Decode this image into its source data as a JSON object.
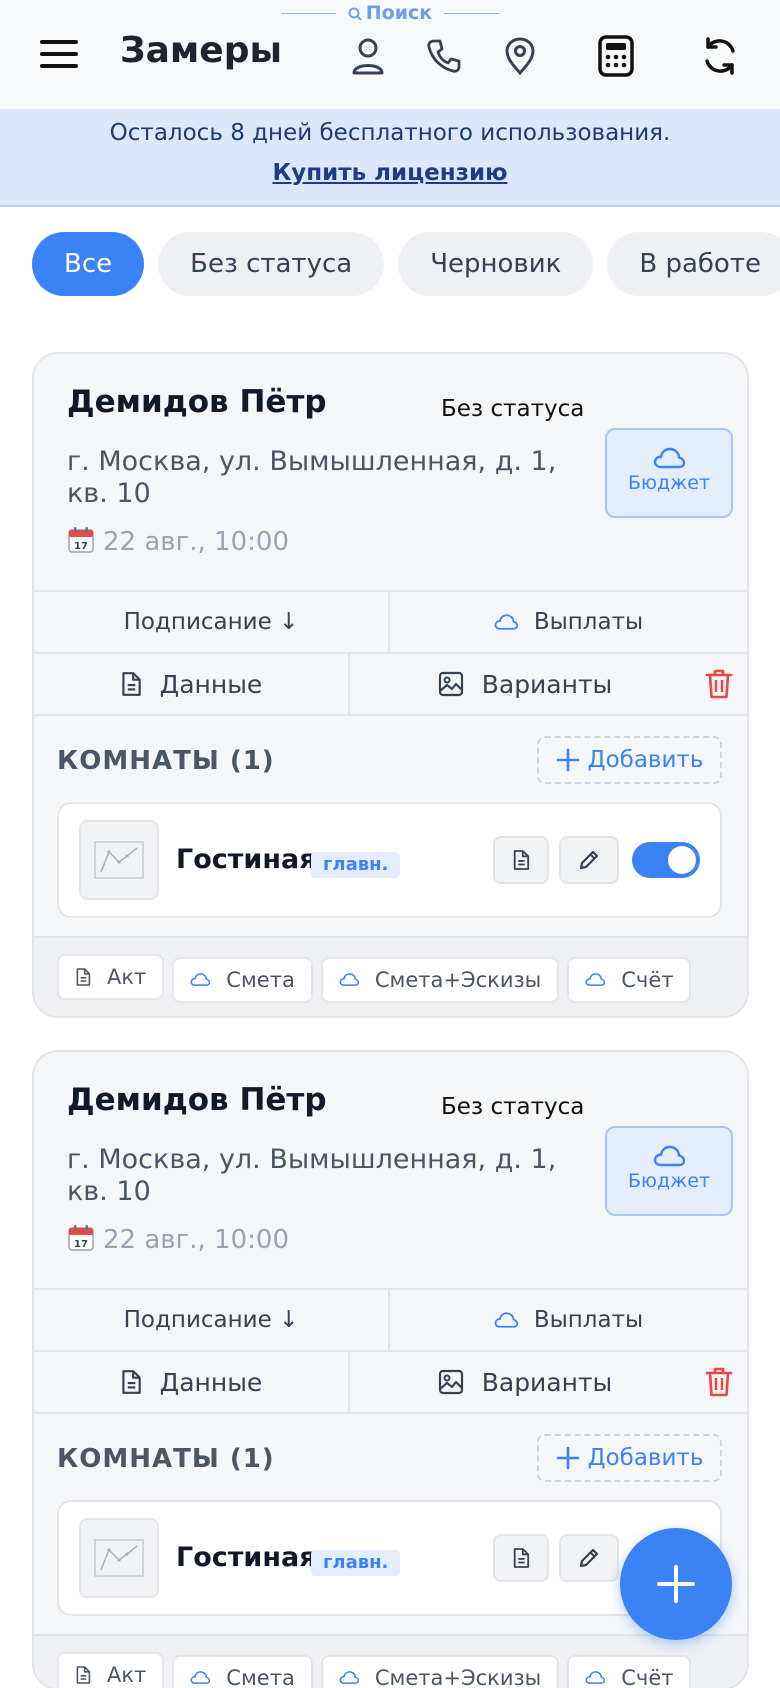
{
  "header": {
    "search_hint": "Поиск",
    "title": "Замеры"
  },
  "banner": {
    "text": "Осталось 8 дней бесплатного использования.",
    "link": "Купить лицензию"
  },
  "filters": [
    "Все",
    "Без статуса",
    "Черновик",
    "В работе"
  ],
  "cards": [
    {
      "client": "Демидов Пётр",
      "status": "Без статуса",
      "address": "г. Москва, ул. Вымышленная, д. 1, кв. 10",
      "date": "22 авг., 10:00",
      "budget_label": "Бюджет",
      "sign_label": "Подписание ↓",
      "payments_label": "Выплаты",
      "data_label": "Данные",
      "variants_label": "Варианты",
      "rooms_title": "КОМНАТЫ (1)",
      "add_label": "Добавить",
      "room": {
        "name": "Гостиная",
        "tag": "главн.",
        "enabled": true
      },
      "docs": [
        "Акт",
        "Смета",
        "Смета+Эскизы",
        "Счёт"
      ]
    },
    {
      "client": "Демидов Пётр",
      "status": "Без статуса",
      "address": "г. Москва, ул. Вымышленная, д. 1, кв. 10",
      "date": "22 авг., 10:00",
      "budget_label": "Бюджет",
      "sign_label": "Подписание ↓",
      "payments_label": "Выплаты",
      "data_label": "Данные",
      "variants_label": "Варианты",
      "rooms_title": "КОМНАТЫ (1)",
      "add_label": "Добавить",
      "room": {
        "name": "Гостиная",
        "tag": "главн.",
        "enabled": true
      },
      "docs": [
        "Акт",
        "Смета",
        "Смета+Эскизы",
        "Счёт"
      ]
    }
  ],
  "colors": {
    "accent": "#3b82f6",
    "danger": "#ef4444",
    "banner_bg": "#dbe8fb"
  }
}
